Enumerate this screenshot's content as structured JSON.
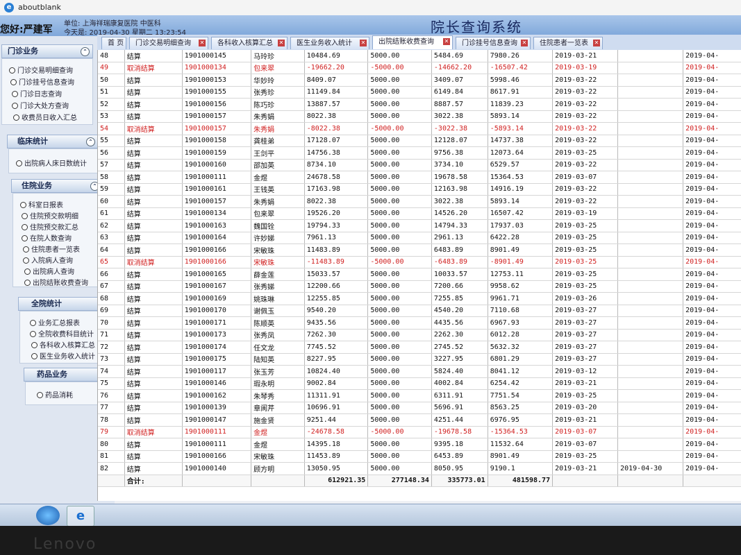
{
  "window": {
    "title": "aboutblank"
  },
  "header": {
    "greeting": "您好:严建军",
    "unit": "单位: 上海祥瑞康复医院  中医科",
    "today": "今天是:  2019-04-30 星期二  13:23:54",
    "system_title": "院长查询系统"
  },
  "tabs": [
    {
      "label": "首 页"
    },
    {
      "label": "门诊交易明细查询"
    },
    {
      "label": "各科收入核算汇总"
    },
    {
      "label": "医生业务收入统计"
    },
    {
      "label": "出院结账收费查询"
    },
    {
      "label": "门诊挂号信息查询"
    },
    {
      "label": "住院患者一览表"
    }
  ],
  "sidebar": {
    "outpatient": {
      "title": "门诊业务",
      "items": [
        "门诊交易明细查询",
        "门诊挂号信息查询",
        "门诊日志查询",
        "门诊大处方查询",
        "收费员日收入汇总"
      ]
    },
    "clinical": {
      "title": "临床统计",
      "items": [
        "出院病人床日数统计"
      ]
    },
    "inpatient": {
      "title": "住院业务",
      "items": [
        "科室日报表",
        "住院预交款明细",
        "住院预交款汇总",
        "在院人数查询",
        "住院患者一览表",
        "入院病人查询",
        "出院病人查询",
        "出院结账收费查询"
      ]
    },
    "hospital": {
      "title": "全院统计",
      "items": [
        "业务汇总报表",
        "全院收费科目统计",
        "各科收入核算汇总",
        "医生业务收入统计"
      ]
    },
    "drug": {
      "title": "药品业务",
      "items": [
        "药品消耗"
      ]
    }
  },
  "grid": {
    "rows": [
      [
        "48",
        "结算",
        "1901000145",
        "马玲珍",
        "10484.69",
        "5000.00",
        "5484.69",
        "7980.26",
        "2019-03-21",
        "",
        "2019-04-"
      ],
      [
        "49",
        "取消结算",
        "1901000134",
        "包来翠",
        "-19662.20",
        "-5000.00",
        "-14662.20",
        "-16507.42",
        "2019-03-19",
        "",
        "2019-04-"
      ],
      [
        "50",
        "结算",
        "1901000153",
        "华妙玲",
        "8409.07",
        "5000.00",
        "3409.07",
        "5998.46",
        "2019-03-22",
        "",
        "2019-04-"
      ],
      [
        "51",
        "结算",
        "1901000155",
        "张秀珍",
        "11149.84",
        "5000.00",
        "6149.84",
        "8617.91",
        "2019-03-22",
        "",
        "2019-04-"
      ],
      [
        "52",
        "结算",
        "1901000156",
        "陈巧珍",
        "13887.57",
        "5000.00",
        "8887.57",
        "11839.23",
        "2019-03-22",
        "",
        "2019-04-"
      ],
      [
        "53",
        "结算",
        "1901000157",
        "朱秀娟",
        "8022.38",
        "5000.00",
        "3022.38",
        "5893.14",
        "2019-03-22",
        "",
        "2019-04-"
      ],
      [
        "54",
        "取消结算",
        "1901000157",
        "朱秀娟",
        "-8022.38",
        "-5000.00",
        "-3022.38",
        "-5893.14",
        "2019-03-22",
        "",
        "2019-04-"
      ],
      [
        "55",
        "结算",
        "1901000158",
        "龚桂弟",
        "17128.07",
        "5000.00",
        "12128.07",
        "14737.38",
        "2019-03-22",
        "",
        "2019-04-"
      ],
      [
        "56",
        "结算",
        "1901000159",
        "王剑平",
        "14756.38",
        "5000.00",
        "9756.38",
        "12073.64",
        "2019-03-25",
        "",
        "2019-04-"
      ],
      [
        "57",
        "结算",
        "1901000160",
        "邵加英",
        "8734.10",
        "5000.00",
        "3734.10",
        "6529.57",
        "2019-03-22",
        "",
        "2019-04-"
      ],
      [
        "58",
        "结算",
        "1901000111",
        "金煜",
        "24678.58",
        "5000.00",
        "19678.58",
        "15364.53",
        "2019-03-07",
        "",
        "2019-04-"
      ],
      [
        "59",
        "结算",
        "1901000161",
        "王钱英",
        "17163.98",
        "5000.00",
        "12163.98",
        "14916.19",
        "2019-03-22",
        "",
        "2019-04-"
      ],
      [
        "60",
        "结算",
        "1901000157",
        "朱秀娟",
        "8022.38",
        "5000.00",
        "3022.38",
        "5893.14",
        "2019-03-22",
        "",
        "2019-04-"
      ],
      [
        "61",
        "结算",
        "1901000134",
        "包来翠",
        "19526.20",
        "5000.00",
        "14526.20",
        "16507.42",
        "2019-03-19",
        "",
        "2019-04-"
      ],
      [
        "62",
        "结算",
        "1901000163",
        "魏国铨",
        "19794.33",
        "5000.00",
        "14794.33",
        "17937.03",
        "2019-03-25",
        "",
        "2019-04-"
      ],
      [
        "63",
        "结算",
        "1901000164",
        "许妙娣",
        "7961.13",
        "5000.00",
        "2961.13",
        "6422.28",
        "2019-03-25",
        "",
        "2019-04-"
      ],
      [
        "64",
        "结算",
        "1901000166",
        "宋敏珠",
        "11483.89",
        "5000.00",
        "6483.89",
        "8901.49",
        "2019-03-25",
        "",
        "2019-04-"
      ],
      [
        "65",
        "取消结算",
        "1901000166",
        "宋敏珠",
        "-11483.89",
        "-5000.00",
        "-6483.89",
        "-8901.49",
        "2019-03-25",
        "",
        "2019-04-"
      ],
      [
        "66",
        "结算",
        "1901000165",
        "薛金莲",
        "15033.57",
        "5000.00",
        "10033.57",
        "12753.11",
        "2019-03-25",
        "",
        "2019-04-"
      ],
      [
        "67",
        "结算",
        "1901000167",
        "张秀娣",
        "12200.66",
        "5000.00",
        "7200.66",
        "9958.62",
        "2019-03-25",
        "",
        "2019-04-"
      ],
      [
        "68",
        "结算",
        "1901000169",
        "姚珠琳",
        "12255.85",
        "5000.00",
        "7255.85",
        "9961.71",
        "2019-03-26",
        "",
        "2019-04-"
      ],
      [
        "69",
        "结算",
        "1901000170",
        "谢佩玉",
        "9540.20",
        "5000.00",
        "4540.20",
        "7110.68",
        "2019-03-27",
        "",
        "2019-04-"
      ],
      [
        "70",
        "结算",
        "1901000171",
        "陈顺英",
        "9435.56",
        "5000.00",
        "4435.56",
        "6967.93",
        "2019-03-27",
        "",
        "2019-04-"
      ],
      [
        "71",
        "结算",
        "1901000173",
        "张秀凤",
        "7262.30",
        "5000.00",
        "2262.30",
        "6012.28",
        "2019-03-27",
        "",
        "2019-04-"
      ],
      [
        "72",
        "结算",
        "1901000174",
        "任文龙",
        "7745.52",
        "5000.00",
        "2745.52",
        "5632.32",
        "2019-03-27",
        "",
        "2019-04-"
      ],
      [
        "73",
        "结算",
        "1901000175",
        "陆知英",
        "8227.95",
        "5000.00",
        "3227.95",
        "6801.29",
        "2019-03-27",
        "",
        "2019-04-"
      ],
      [
        "74",
        "结算",
        "1901000117",
        "张玉芳",
        "10824.40",
        "5000.00",
        "5824.40",
        "8041.12",
        "2019-03-12",
        "",
        "2019-04-"
      ],
      [
        "75",
        "结算",
        "1901000146",
        "瑕永明",
        "9002.84",
        "5000.00",
        "4002.84",
        "6254.42",
        "2019-03-21",
        "",
        "2019-04-"
      ],
      [
        "76",
        "结算",
        "1901000162",
        "朱琴秀",
        "11311.91",
        "5000.00",
        "6311.91",
        "7751.54",
        "2019-03-25",
        "",
        "2019-04-"
      ],
      [
        "77",
        "结算",
        "1901000139",
        "章阆芹",
        "10696.91",
        "5000.00",
        "5696.91",
        "8563.25",
        "2019-03-20",
        "",
        "2019-04-"
      ],
      [
        "78",
        "结算",
        "1901000147",
        "施金贤",
        "9251.44",
        "5000.00",
        "4251.44",
        "6976.95",
        "2019-03-21",
        "",
        "2019-04-"
      ],
      [
        "79",
        "取消结算",
        "1901000111",
        "金煜",
        "-24678.58",
        "-5000.00",
        "-19678.58",
        "-15364.53",
        "2019-03-07",
        "",
        "2019-04-"
      ],
      [
        "80",
        "结算",
        "1901000111",
        "金煜",
        "14395.18",
        "5000.00",
        "9395.18",
        "11532.64",
        "2019-03-07",
        "",
        "2019-04-"
      ],
      [
        "81",
        "结算",
        "1901000166",
        "宋敏珠",
        "11453.89",
        "5000.00",
        "6453.89",
        "8901.49",
        "2019-03-25",
        "",
        "2019-04-"
      ],
      [
        "82",
        "结算",
        "1901000140",
        "顾方明",
        "13050.95",
        "5000.00",
        "8050.95",
        "9190.1",
        "2019-03-21",
        "2019-04-30",
        "2019-04-"
      ]
    ],
    "totals": {
      "label": "合计:",
      "amount": "612921.35",
      "deposit": "277148.34",
      "balance": "335773.01",
      "other": "481598.77"
    }
  },
  "brand": "Lenovo",
  "colors": {
    "cancel_text": "#d02020",
    "header_bg": "#8fb2df",
    "title_text": "#1a2a60"
  }
}
